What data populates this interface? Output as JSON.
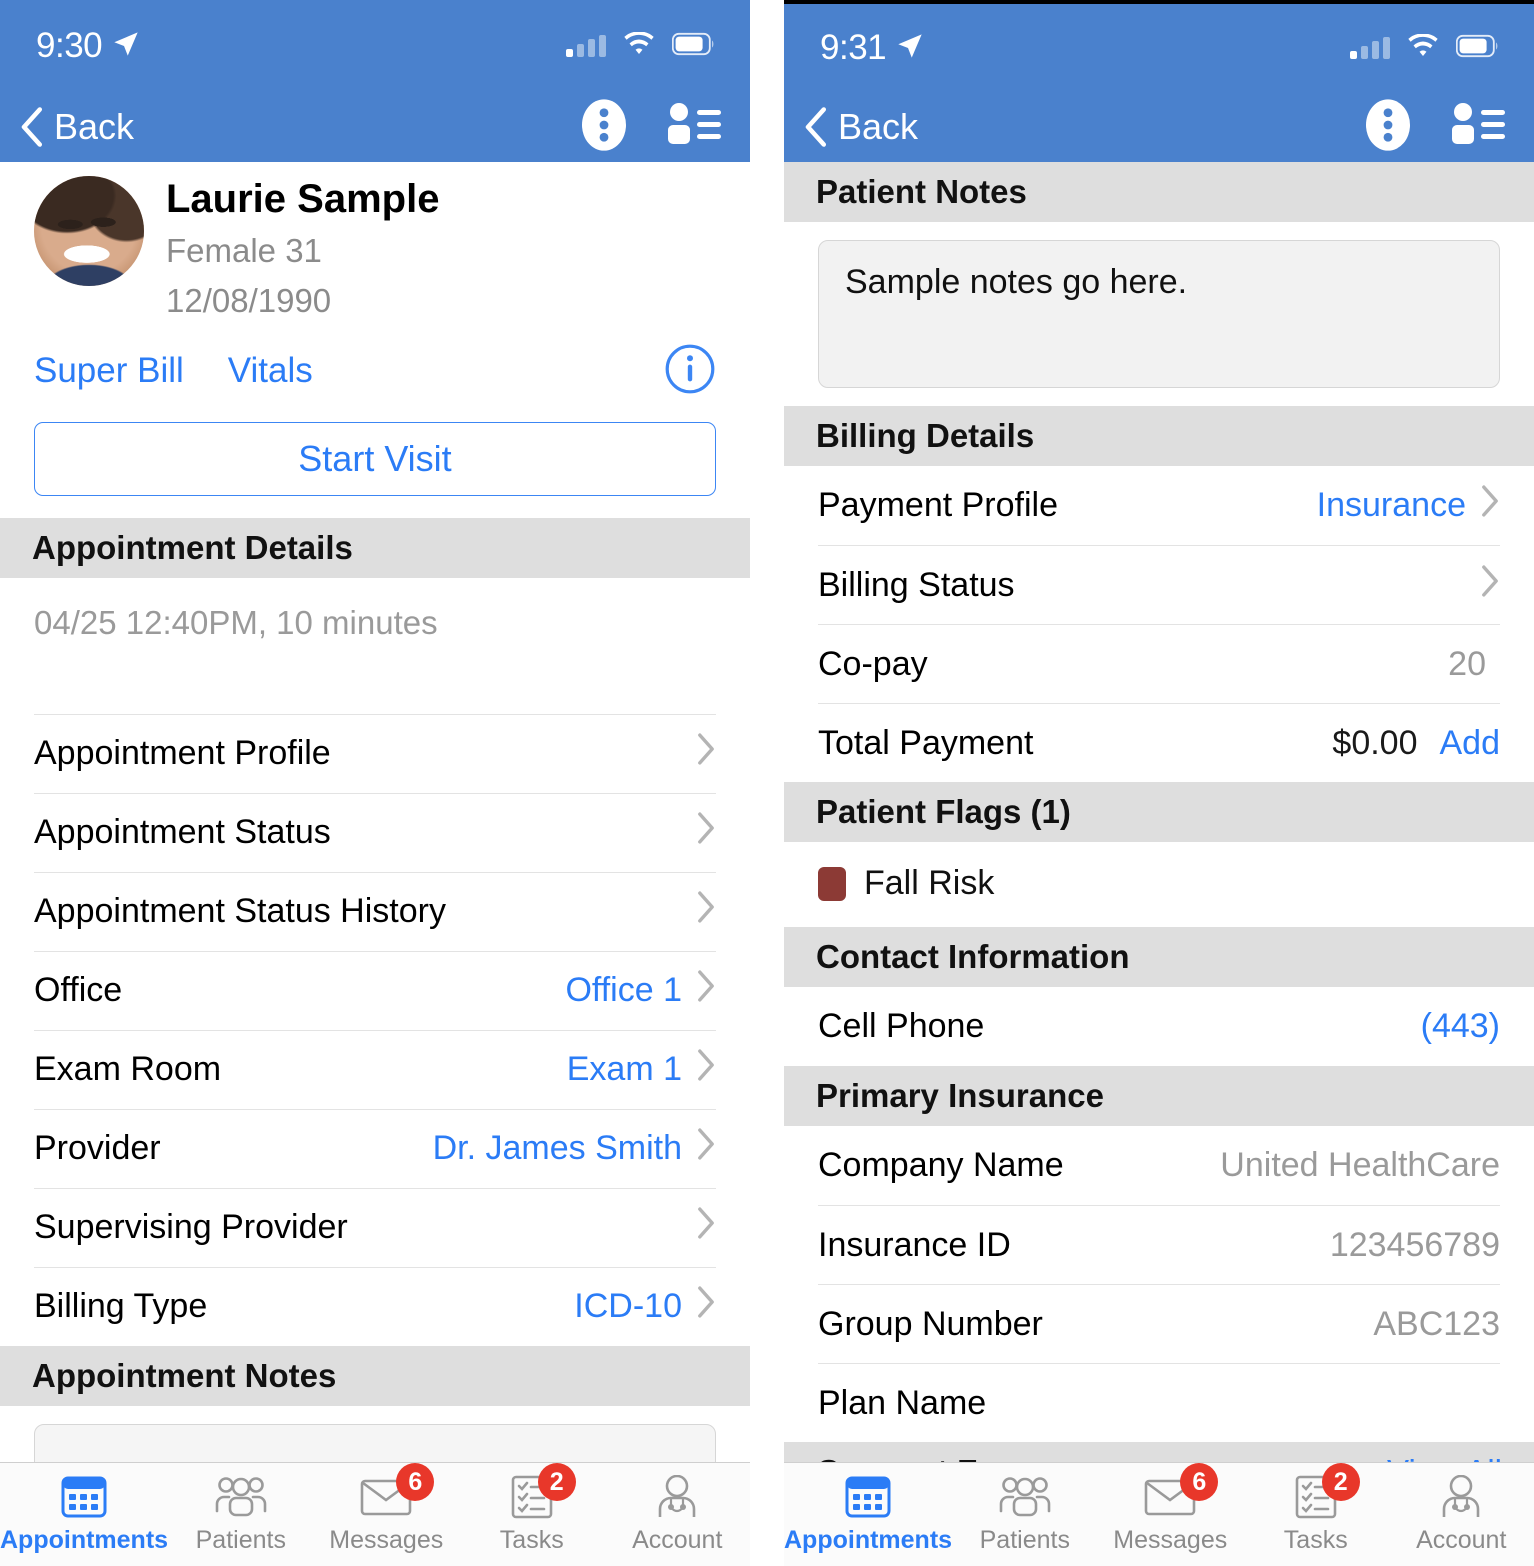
{
  "left": {
    "status": {
      "time": "9:30",
      "location_icon": "location-arrow-icon"
    },
    "nav": {
      "back_label": "Back",
      "overflow_icon": "more-vertical-icon",
      "roster_icon": "patient-list-icon"
    },
    "patient": {
      "name": "Laurie Sample",
      "sex_age": "Female 31",
      "dob": "12/08/1990",
      "links": [
        "Super Bill",
        "Vitals"
      ],
      "info_icon": "info-circle-icon"
    },
    "start_visit_label": "Start Visit",
    "appointment_details": {
      "header": "Appointment Details",
      "when": "04/25 12:40PM, 10 minutes",
      "rows": [
        {
          "label": "Appointment Profile",
          "value": "",
          "value_style": ""
        },
        {
          "label": "Appointment Status",
          "value": "",
          "value_style": ""
        },
        {
          "label": "Appointment Status History",
          "value": "",
          "value_style": ""
        },
        {
          "label": "Office",
          "value": "Office 1",
          "value_style": "link"
        },
        {
          "label": "Exam Room",
          "value": "Exam 1",
          "value_style": "link"
        },
        {
          "label": "Provider",
          "value": "Dr. James Smith",
          "value_style": "link"
        },
        {
          "label": "Supervising Provider",
          "value": "",
          "value_style": ""
        },
        {
          "label": "Billing Type",
          "value": "ICD-10",
          "value_style": "link"
        }
      ]
    },
    "appointment_notes": {
      "header": "Appointment Notes",
      "value": ""
    }
  },
  "right": {
    "status": {
      "time": "9:31",
      "location_icon": "location-arrow-icon"
    },
    "nav": {
      "back_label": "Back",
      "overflow_icon": "more-vertical-icon",
      "roster_icon": "patient-list-icon"
    },
    "patient_notes": {
      "header": "Patient Notes",
      "value": "Sample notes go here."
    },
    "billing_details": {
      "header": "Billing Details",
      "rows": [
        {
          "label": "Payment Profile",
          "value": "Insurance",
          "value_style": "link",
          "chevron": true
        },
        {
          "label": "Billing Status",
          "value": "",
          "value_style": "",
          "chevron": true
        },
        {
          "label": "Co-pay",
          "value": "20",
          "value_style": "grey",
          "chevron": false
        },
        {
          "label": "Total Payment",
          "value": "$0.00",
          "value_style": "dark",
          "chevron": false,
          "action": "Add"
        }
      ]
    },
    "patient_flags": {
      "header": "Patient Flags (1)",
      "items": [
        {
          "label": "Fall Risk",
          "color": "#8c3a35"
        }
      ]
    },
    "contact_information": {
      "header": "Contact Information",
      "rows": [
        {
          "label": "Cell Phone",
          "value": "(443)",
          "value_style": "link",
          "chevron": false
        }
      ]
    },
    "primary_insurance": {
      "header": "Primary Insurance",
      "rows": [
        {
          "label": "Company Name",
          "value": "United HealthCare",
          "value_style": "grey",
          "chevron": false
        },
        {
          "label": "Insurance ID",
          "value": "123456789",
          "value_style": "grey",
          "chevron": false
        },
        {
          "label": "Group Number",
          "value": "ABC123",
          "value_style": "grey",
          "chevron": false
        },
        {
          "label": "Plan Name",
          "value": "",
          "value_style": "grey",
          "chevron": false
        }
      ]
    },
    "consent_forms": {
      "header": "Consent Forms",
      "view_all": "View All"
    }
  },
  "tabbar": {
    "items": [
      {
        "label": "Appointments",
        "icon": "calendar-icon",
        "active": true,
        "badge": ""
      },
      {
        "label": "Patients",
        "icon": "people-icon",
        "active": false,
        "badge": ""
      },
      {
        "label": "Messages",
        "icon": "envelope-icon",
        "active": false,
        "badge": "6"
      },
      {
        "label": "Tasks",
        "icon": "checklist-icon",
        "active": false,
        "badge": "2"
      },
      {
        "label": "Account",
        "icon": "doctor-icon",
        "active": false,
        "badge": ""
      }
    ]
  },
  "colors": {
    "nav_blue": "#4a81cd",
    "accent_blue": "#2b7cf6",
    "section_grey": "#dedede",
    "badge_red": "#e8372a",
    "flag_red": "#8c3a35"
  }
}
